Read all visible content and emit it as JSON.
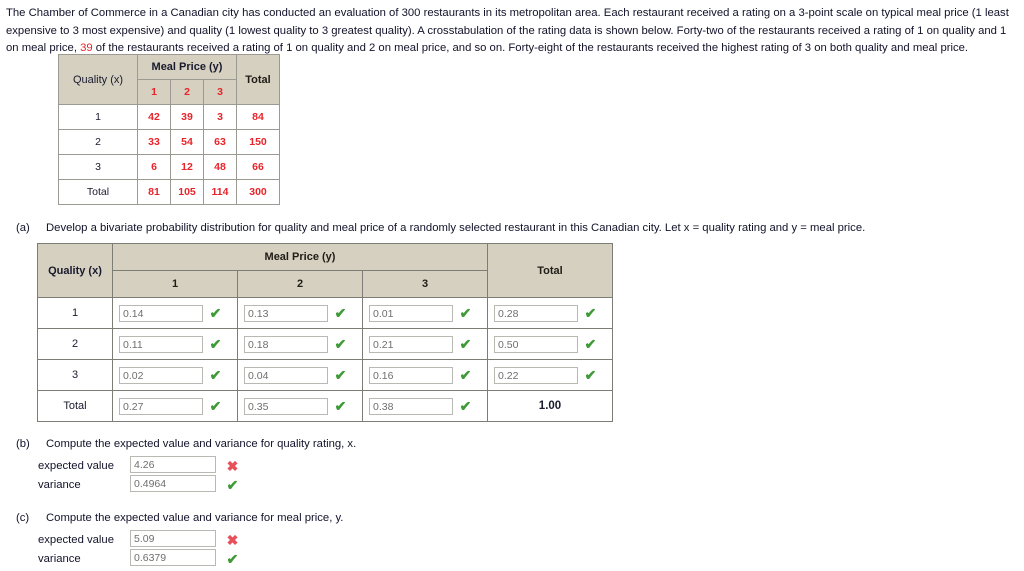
{
  "intro": {
    "part1": "The Chamber of Commerce in a Canadian city has conducted an evaluation of 300 restaurants in its metropolitan area. Each restaurant received a rating on a 3-point scale on typical meal price (1 least expensive to 3 most expensive) and quality (1 lowest quality to 3 greatest quality). A crosstabulation of the rating data is shown below. Forty-two of the restaurants received a rating of 1 on quality and 1 on meal price, ",
    "highlight": "39",
    "part2": " of the restaurants received a rating of 1 on quality and 2 on meal price, and so on. Forty-eight of the restaurants received the highest rating of 3 on both quality and meal price."
  },
  "crosstab": {
    "group_header": "Meal Price (y)",
    "row_header": "Quality (x)",
    "col_headers": [
      "1",
      "2",
      "3"
    ],
    "total_header": "Total",
    "rows": [
      {
        "label": "1",
        "values": [
          "42",
          "39",
          "3"
        ],
        "total": "84"
      },
      {
        "label": "2",
        "values": [
          "33",
          "54",
          "63"
        ],
        "total": "150"
      },
      {
        "label": "3",
        "values": [
          "6",
          "12",
          "48"
        ],
        "total": "66"
      }
    ],
    "total_row": {
      "label": "Total",
      "values": [
        "81",
        "105",
        "114"
      ],
      "total": "300"
    }
  },
  "parts": {
    "a": {
      "index": "(a)",
      "text": "Develop a bivariate probability distribution for quality and meal price of a randomly selected restaurant in this Canadian city. Let x = quality rating and y = meal price."
    },
    "b": {
      "index": "(b)",
      "text": "Compute the expected value and variance for quality rating, x.",
      "expected_label": "expected value",
      "expected_value": "4.26",
      "expected_mark": "incorrect",
      "variance_label": "variance",
      "variance_value": "0.4964",
      "variance_mark": "correct"
    },
    "c": {
      "index": "(c)",
      "text": "Compute the expected value and variance for meal price, y.",
      "expected_label": "expected value",
      "expected_value": "5.09",
      "expected_mark": "incorrect",
      "variance_label": "variance",
      "variance_value": "0.6379",
      "variance_mark": "correct"
    }
  },
  "probtab": {
    "group_header": "Meal Price (y)",
    "row_header": "Quality (x)",
    "col_headers": [
      "1",
      "2",
      "3"
    ],
    "total_header": "Total",
    "rows": [
      {
        "label": "1",
        "values": [
          "0.14",
          "0.13",
          "0.01"
        ],
        "total": "0.28"
      },
      {
        "label": "2",
        "values": [
          "0.11",
          "0.18",
          "0.21"
        ],
        "total": "0.50"
      },
      {
        "label": "3",
        "values": [
          "0.02",
          "0.04",
          "0.16"
        ],
        "total": "0.22"
      }
    ],
    "total_row": {
      "label": "Total",
      "values": [
        "0.27",
        "0.35",
        "0.38"
      ],
      "grand_total": "1.00"
    }
  },
  "glyphs": {
    "check": "✔",
    "cross": "✖"
  },
  "colors": {
    "header_bg": "#d5d0c0",
    "data_red": "#e8242a",
    "correct_green": "#3d9a36",
    "incorrect_red": "#e8505b"
  }
}
